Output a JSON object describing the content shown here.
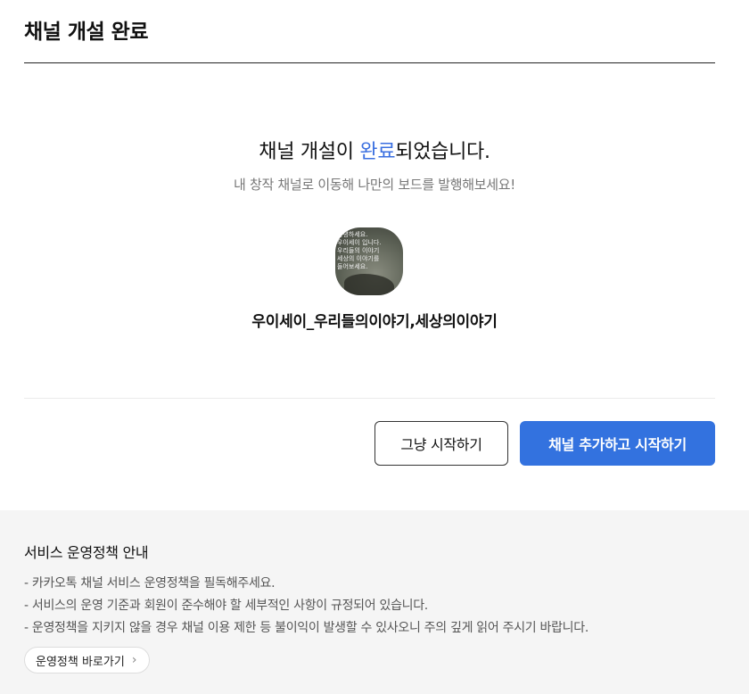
{
  "header": {
    "title": "채널 개설 완료"
  },
  "completion": {
    "title_before": "채널 개설이 ",
    "title_accent": "완료",
    "title_after": "되었습니다.",
    "subtitle": "내 창작 채널로 이동해 나만의 보드를 발행해보세요!",
    "channel_name": "우이세이_우리들의이야기,세상의이야기",
    "avatar_text": "안녕하세요.\n우이세이 입니다.\n우리들의 이야기\n세상의 이야기를\n들어보세요."
  },
  "actions": {
    "plain_label": "그냥 시작하기",
    "primary_label": "채널 추가하고 시작하기"
  },
  "policy": {
    "title": "서비스 운영정책 안내",
    "items": [
      "- 카카오톡 채널 서비스 운영정책을 필독해주세요.",
      "- 서비스의 운영 기준과 회원이 준수해야 할 세부적인 사항이 규정되어 있습니다.",
      "- 운영정책을 지키지 않을 경우 채널 이용 제한 등 불이익이 발생할 수 있사오니 주의 깊게 읽어 주시기 바랍니다."
    ],
    "link_label": "운영정책 바로가기",
    "link_icon": "chevron-right-icon"
  },
  "colors": {
    "accent": "#3a6fe0",
    "primary_button": "#3372df",
    "policy_bg": "#f5f5f5"
  }
}
